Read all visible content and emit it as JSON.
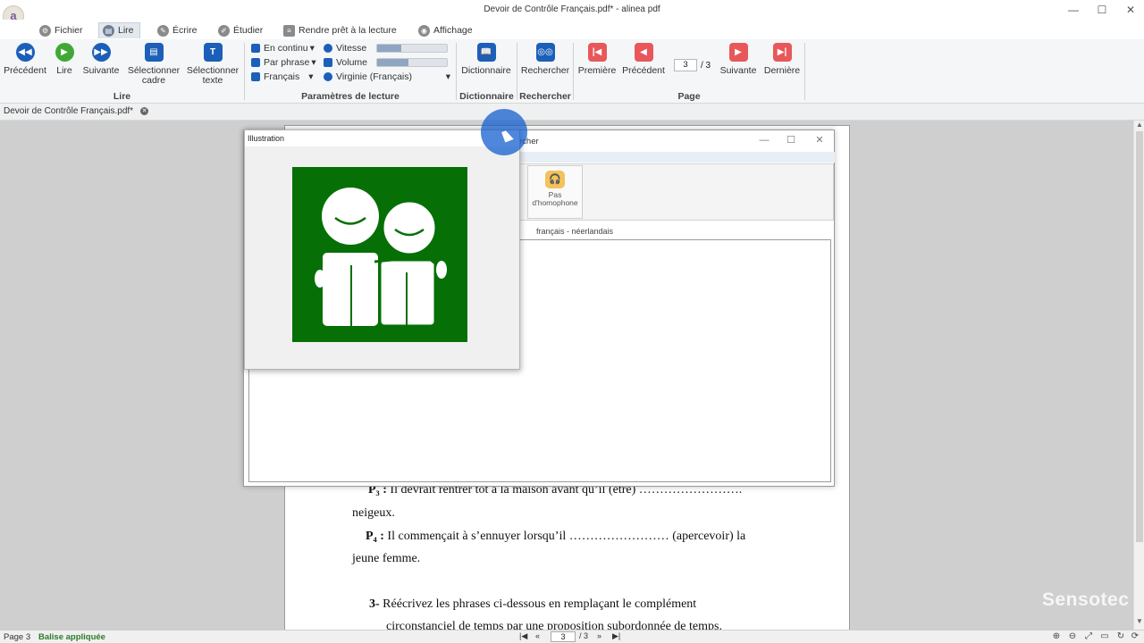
{
  "window": {
    "title": "Devoir de Contrôle Français.pdf* - alinea pdf",
    "app_logo": "a",
    "minimize_glyph": "—",
    "maximize_glyph": "☐",
    "close_glyph": "✕"
  },
  "menu": {
    "tabs": [
      {
        "label": "Fichier",
        "icon": "gear-icon"
      },
      {
        "label": "Lire",
        "icon": "read-icon"
      },
      {
        "label": "Écrire",
        "icon": "pen-icon"
      },
      {
        "label": "Étudier",
        "icon": "study-icon"
      },
      {
        "label": "Rendre prêt à la lecture",
        "icon": "document-icon"
      },
      {
        "label": "Affichage",
        "icon": "eye-icon"
      }
    ],
    "active": "Lire"
  },
  "ribbon": {
    "lire": {
      "group_label": "Lire",
      "precedent": "Précédent",
      "lire": "Lire",
      "suivante": "Suivante",
      "select_frame_1": "Sélectionner",
      "select_frame_2": "cadre",
      "select_text_1": "Sélectionner",
      "select_text_2": "texte"
    },
    "reading_params": {
      "group_label": "Paramètres de lecture",
      "mode": "En continu",
      "unit": "Par phrase",
      "language": "Français",
      "speed_label": "Vitesse",
      "volume_label": "Volume",
      "voice": "Virginie (Français)",
      "speed_level": 0.35,
      "volume_level": 0.45
    },
    "dictionnaire": {
      "group_label": "Dictionnaire",
      "button": "Dictionnaire"
    },
    "rechercher": {
      "group_label": "Rechercher",
      "button": "Rechercher"
    },
    "page": {
      "group_label": "Page",
      "first": "Première",
      "previous": "Précédent",
      "next": "Suivante",
      "last": "Dernière",
      "current": "3",
      "total": "/ 3"
    }
  },
  "doc_tab": {
    "label": "Devoir de Contrôle Français.pdf*",
    "close_glyph": "✕"
  },
  "pdf": {
    "p3_label": "P₃ :",
    "p3_text": "Il devrait rentrer tôt à la maison avant qu’il (être) …………………….",
    "line_neigeux": "neigeux.",
    "p4_label": "P₄ :",
    "p4_text": "Il commençait à s’ennuyer lorsqu’il …………………… (apercevoir) la",
    "line_jeune": "jeune femme.",
    "q3_label": "3-",
    "q3_text": "Réécrivez les phrases ci-dessous en remplaçant le complément",
    "q3_text2": "circonstanciel de temps par une proposition subordonnée de temps."
  },
  "dictionary_dialog": {
    "title_fragment": "rcher",
    "homophone_1": "Pas",
    "homophone_2": "d'homophone",
    "lang_tab": "français - néerlandais"
  },
  "illustration": {
    "title": "Illustration",
    "image_fill": "#067006"
  },
  "status": {
    "page": "Page 3",
    "tag": "Balise appliquée",
    "current_page": "3",
    "total": "/ 3"
  },
  "watermark": "Sensotec"
}
